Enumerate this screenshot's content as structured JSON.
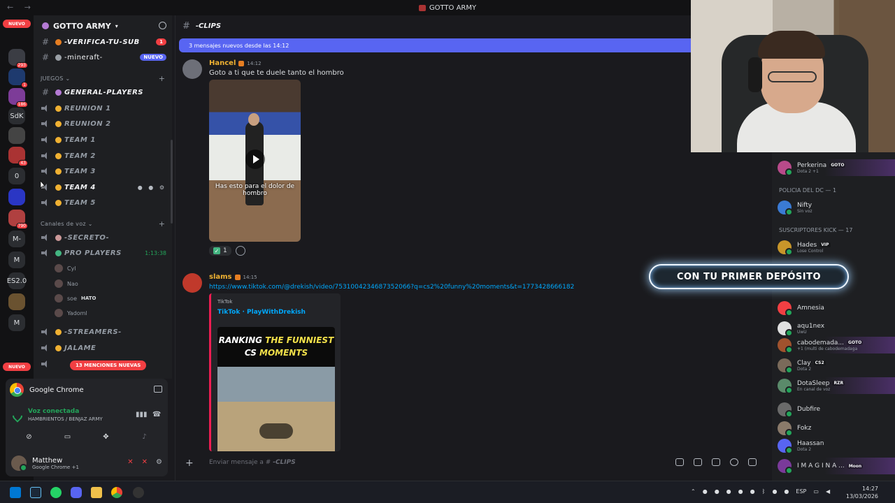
{
  "window": {
    "title": "GOTTO ARMY",
    "nav": "← →"
  },
  "rail": {
    "nuevo_top": "NUEVO",
    "nuevo_bottom": "NUEVO",
    "servers": [
      {
        "label": "",
        "badge": "293",
        "color": "#3b3d44"
      },
      {
        "label": "",
        "badge": "1",
        "color": "#1e3a6e"
      },
      {
        "label": "",
        "badge": "186",
        "color": "#7d3c98"
      },
      {
        "label": "SdK",
        "badge": "",
        "color": "#2b2d31"
      },
      {
        "label": "",
        "badge": "",
        "color": "#444"
      },
      {
        "label": "",
        "badge": "43",
        "color": "#a33"
      },
      {
        "label": "0",
        "badge": "",
        "color": "#2b2d31"
      },
      {
        "label": "",
        "badge": "",
        "color": "#2a36c4"
      },
      {
        "label": "",
        "badge": "790",
        "color": "#b04040"
      },
      {
        "label": "M-",
        "badge": "",
        "color": "#2b2d31"
      },
      {
        "label": "M",
        "badge": "",
        "color": "#2b2d31"
      },
      {
        "label": "ES2.0",
        "badge": "",
        "color": "#2b2d31"
      },
      {
        "label": "",
        "badge": "",
        "color": "#6a5230"
      },
      {
        "label": "M",
        "badge": "",
        "color": "#2b2d31"
      }
    ]
  },
  "guild": {
    "name": "GOTTO ARMY"
  },
  "channels": {
    "top": [
      {
        "name": "-VERIFICA-TU-SUB",
        "badge": "1",
        "badge_color": "#f23f43"
      },
      {
        "name": "-mineraft-",
        "badge": "NUEVO",
        "badge_color": "#5865f2"
      }
    ],
    "cat_juegos": "JUEGOS",
    "juegos": [
      {
        "name": "GENERAL-PLAYERS",
        "type": "text"
      },
      {
        "name": "REUNION 1",
        "type": "voice"
      },
      {
        "name": "REUNION 2",
        "type": "voice"
      },
      {
        "name": "TEAM 1",
        "type": "voice"
      },
      {
        "name": "TEAM 2",
        "type": "voice"
      },
      {
        "name": "TEAM 3",
        "type": "voice"
      },
      {
        "name": "TEAM 4",
        "type": "voice"
      },
      {
        "name": "TEAM 5",
        "type": "voice"
      }
    ],
    "cat_voz": "Canales de voz",
    "voz": [
      {
        "name": "-SECRETO-"
      },
      {
        "name": "PRO PLAYERS",
        "time": "1:13:38"
      }
    ],
    "voice_users": [
      {
        "name": "Cyl",
        "tag": ""
      },
      {
        "name": "Nao",
        "tag": ""
      },
      {
        "name": "soe",
        "tag": "HATO"
      },
      {
        "name": "Yadoml",
        "tag": ""
      }
    ],
    "more": [
      {
        "name": "-STREAMERS-"
      },
      {
        "name": "JALAME"
      }
    ],
    "mentions": "13 MENCIONES NUEVAS"
  },
  "panel": {
    "activity": "Google Chrome",
    "voice_status": "Voz conectada",
    "voice_channel": "HAMBRIENTOS / BENJAZ ARMY",
    "user_name": "Matthew",
    "user_status": "Google Chrome +1"
  },
  "chat": {
    "channel": "-CLIPS",
    "new_messages": "3 mensajes nuevos desde las 14:12",
    "messages": [
      {
        "author": "Hancel",
        "time": "14:12",
        "text": "Goto a ti que te duele tanto el hombro",
        "video_caption": "Has esto para el dolor de hombro",
        "reaction_count": "1"
      },
      {
        "author": "slams",
        "time": "14:15",
        "link": "https://www.tiktok.com/@drekish/video/7531004234687352066?q=cs2%20funny%20moments&t=1773428666182",
        "embed_provider": "TikTok",
        "embed_title": "TikTok · PlayWithDrekish",
        "thumb_line1": "RANKING ",
        "thumb_line1_hl": "THE FUNNIEST",
        "thumb_line2": "CS ",
        "thumb_line2_hl": "MOMENTS"
      }
    ],
    "composer_placeholder": "Enviar mensaje a #",
    "composer_channel": "-CLIPS"
  },
  "members": {
    "roles": [
      {
        "name": "POLICIA DEL DC — 1"
      },
      {
        "name": "SUSCRIPTORES KICK — 17"
      }
    ],
    "list": [
      {
        "name": "Perkerina",
        "tag": "GOTO",
        "sub": "Dota 2 +1",
        "color": "#b84a8a"
      },
      {
        "name": "Nifty",
        "tag": "",
        "sub": "Sin voz",
        "color": "#3a7bd5"
      },
      {
        "name": "Hades",
        "tag": "VIP",
        "sub": "Lose Control",
        "color": "#c8962a"
      },
      {
        "name": "Amnesia",
        "tag": "",
        "sub": "",
        "color": "#f23f43"
      },
      {
        "name": "aqu1nex",
        "tag": "",
        "sub": "UwU",
        "color": "#e0e0e0"
      },
      {
        "name": "cabodemada...",
        "tag": "GOTO",
        "sub": "+1 (multi de cabodemadaga",
        "color": "#a0522d"
      },
      {
        "name": "Clay",
        "tag": "CS2",
        "sub": "Dota 2",
        "color": "#7a6a5a"
      },
      {
        "name": "DotaSleep",
        "tag": "RZR",
        "sub": "En canal de voz",
        "color": "#5a8a6a"
      },
      {
        "name": "Dubfire",
        "tag": "",
        "sub": "",
        "color": "#6a6a6a"
      },
      {
        "name": "Fokz",
        "tag": "",
        "sub": "",
        "color": "#8a7a6a"
      },
      {
        "name": "Haassan",
        "tag": "",
        "sub": "Dota 2",
        "color": "#5865f2"
      },
      {
        "name": "I M A G I N A ...",
        "tag": "Moon",
        "sub": "",
        "color": "#7a3a9a"
      }
    ]
  },
  "overlay": {
    "promo": "CON TU PRIMER DEPÓSITO"
  },
  "taskbar": {
    "lang": "ESP",
    "time": "14:27",
    "date": "13/03/2026"
  }
}
